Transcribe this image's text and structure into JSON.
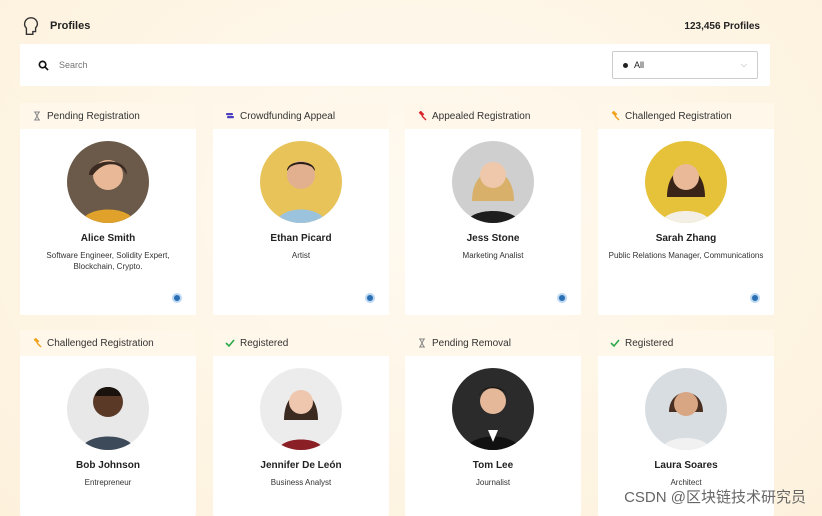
{
  "header": {
    "title": "Profiles",
    "count": "123,456 Profiles"
  },
  "search": {
    "placeholder": "Search"
  },
  "filter": {
    "selected": "All"
  },
  "colors": {
    "accent_pending": "#888888",
    "accent_crowdfunding": "#4b3fc2",
    "accent_appealed": "#d9262b",
    "accent_challenged": "#f2a21a",
    "accent_registered": "#2aa84a",
    "chain_badge": "#2a6fb3"
  },
  "cards": [
    {
      "status": "Pending Registration",
      "status_icon": "hourglass-icon",
      "name": "Alice Smith",
      "role": "Software Engineer, Solidity Expert, Blockchain, Crypto."
    },
    {
      "status": "Crowdfunding Appeal",
      "status_icon": "coins-icon",
      "name": "Ethan Picard",
      "role": "Artist"
    },
    {
      "status": "Appealed Registration",
      "status_icon": "gavel-icon",
      "name": "Jess Stone",
      "role": "Marketing Analist"
    },
    {
      "status": "Challenged Registration",
      "status_icon": "gavel-icon",
      "name": "Sarah Zhang",
      "role": "Public Relations Manager, Communications"
    },
    {
      "status": "Challenged Registration",
      "status_icon": "gavel-icon",
      "name": "Bob Johnson",
      "role": "Entrepreneur"
    },
    {
      "status": "Registered",
      "status_icon": "check-icon",
      "name": "Jennifer De León",
      "role": "Business Analyst"
    },
    {
      "status": "Pending Removal",
      "status_icon": "hourglass-icon",
      "name": "Tom Lee",
      "role": "Journalist"
    },
    {
      "status": "Registered",
      "status_icon": "check-icon",
      "name": "Laura Soares",
      "role": "Architect"
    }
  ],
  "watermark": "CSDN @区块链技术研究员"
}
